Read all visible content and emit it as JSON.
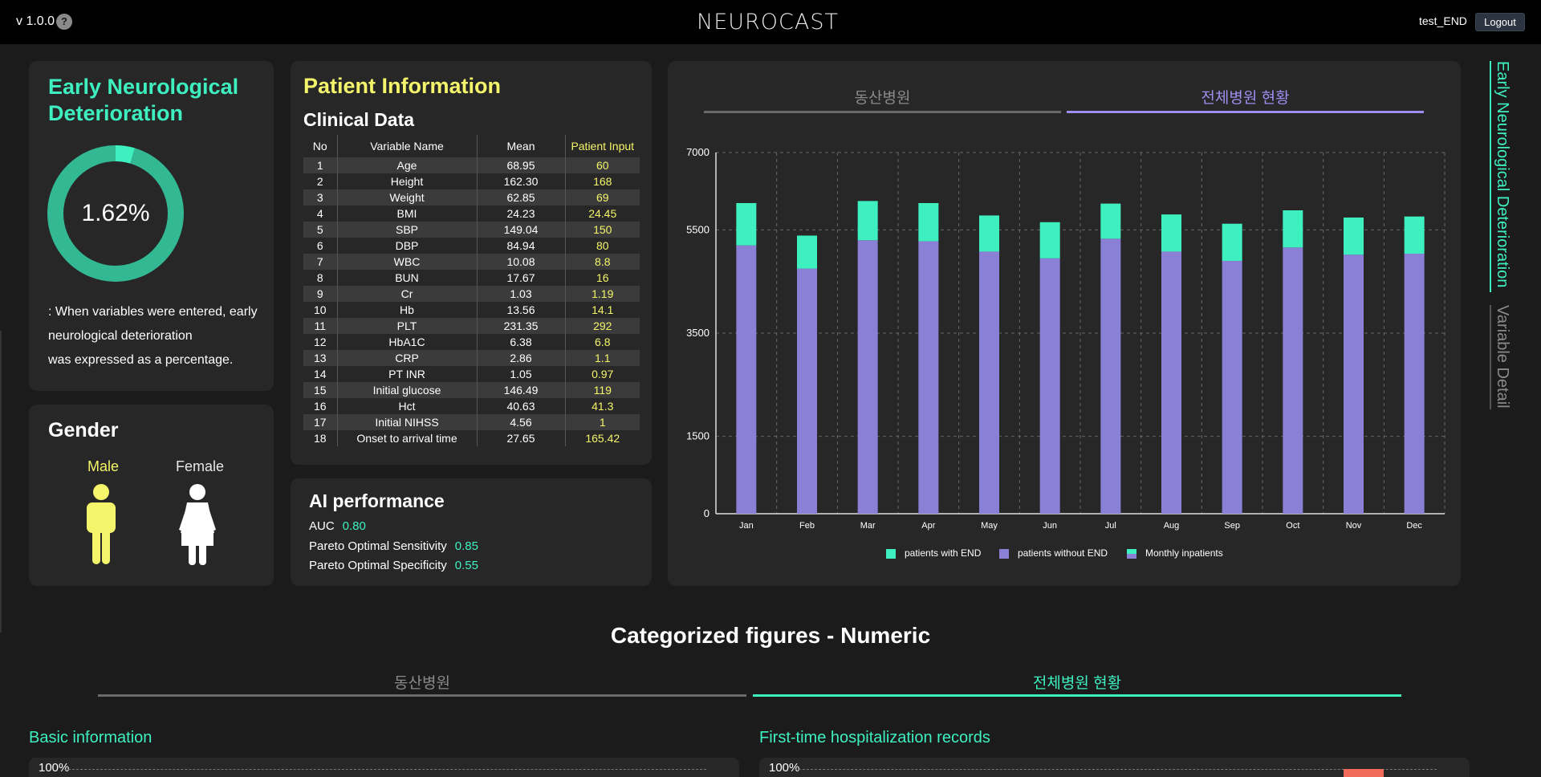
{
  "header": {
    "version": "v 1.0.0",
    "help_icon": "?",
    "logo": "NEUROCAST",
    "username": "test_END",
    "logout_label": "Logout"
  },
  "end_card": {
    "title": "Early Neurological Deterioration",
    "percent_value": 1.62,
    "percent_label": "1.62%",
    "note_line1": ": When variables were entered, early",
    "note_line2": "neurological deterioration",
    "note_line3": "was expressed as a percentage.",
    "ring_color": "#33b894",
    "ring_highlight_color": "#3ef0c0"
  },
  "gender": {
    "title": "Gender",
    "male_label": "Male",
    "female_label": "Female",
    "selected": "Male",
    "male_color": "#f5f56b",
    "female_color": "#ffffff"
  },
  "patient_info": {
    "title": "Patient Information",
    "subtitle": "Clinical Data",
    "columns": [
      "No",
      "Variable Name",
      "Mean",
      "Patient Input"
    ],
    "rows": [
      {
        "no": "1",
        "name": "Age",
        "mean": "68.95",
        "input": "60"
      },
      {
        "no": "2",
        "name": "Height",
        "mean": "162.30",
        "input": "168"
      },
      {
        "no": "3",
        "name": "Weight",
        "mean": "62.85",
        "input": "69"
      },
      {
        "no": "4",
        "name": "BMI",
        "mean": "24.23",
        "input": "24.45"
      },
      {
        "no": "5",
        "name": "SBP",
        "mean": "149.04",
        "input": "150"
      },
      {
        "no": "6",
        "name": "DBP",
        "mean": "84.94",
        "input": "80"
      },
      {
        "no": "7",
        "name": "WBC",
        "mean": "10.08",
        "input": "8.8"
      },
      {
        "no": "8",
        "name": "BUN",
        "mean": "17.67",
        "input": "16"
      },
      {
        "no": "9",
        "name": "Cr",
        "mean": "1.03",
        "input": "1.19"
      },
      {
        "no": "10",
        "name": "Hb",
        "mean": "13.56",
        "input": "14.1"
      },
      {
        "no": "11",
        "name": "PLT",
        "mean": "231.35",
        "input": "292"
      },
      {
        "no": "12",
        "name": "HbA1C",
        "mean": "6.38",
        "input": "6.8"
      },
      {
        "no": "13",
        "name": "CRP",
        "mean": "2.86",
        "input": "1.1"
      },
      {
        "no": "14",
        "name": "PT INR",
        "mean": "1.05",
        "input": "0.97"
      },
      {
        "no": "15",
        "name": "Initial glucose",
        "mean": "146.49",
        "input": "119"
      },
      {
        "no": "16",
        "name": "Hct",
        "mean": "40.63",
        "input": "41.3"
      },
      {
        "no": "17",
        "name": "Initial NIHSS",
        "mean": "4.56",
        "input": "1"
      },
      {
        "no": "18",
        "name": "Onset to arrival time",
        "mean": "27.65",
        "input": "165.42"
      }
    ]
  },
  "ai_performance": {
    "title": "AI performance",
    "auc_label": "AUC",
    "auc_value": "0.80",
    "sensitivity_label": "Pareto Optimal Sensitivity",
    "sensitivity_value": "0.85",
    "specificity_label": "Pareto Optimal Specificity",
    "specificity_value": "0.55"
  },
  "inpatient_chart": {
    "tabs": [
      {
        "label": "동산병원",
        "active": false
      },
      {
        "label": "전체병원 현황",
        "active": true
      }
    ],
    "active_color": "#9c8ff0",
    "inactive_color": "#8a8a8a"
  },
  "chart_data": {
    "type": "bar",
    "stacked": true,
    "categories": [
      "Jan",
      "Feb",
      "Mar",
      "Apr",
      "May",
      "Jun",
      "Jul",
      "Aug",
      "Sep",
      "Oct",
      "Nov",
      "Dec"
    ],
    "series": [
      {
        "name": "patients without END",
        "color": "#8a80d6",
        "values": [
          5200,
          4750,
          5300,
          5280,
          5080,
          4950,
          5330,
          5080,
          4900,
          5160,
          5020,
          5040
        ]
      },
      {
        "name": "patients with END",
        "color": "#3ef0c0",
        "values": [
          820,
          640,
          760,
          740,
          700,
          700,
          680,
          720,
          720,
          720,
          720,
          720
        ]
      }
    ],
    "legend": [
      "patients with END",
      "patients without END",
      "Monthly inpatients"
    ],
    "legend_placement": "bottom",
    "yticks": [
      0,
      1500,
      3500,
      5500,
      7000
    ],
    "ylim": [
      0,
      7000
    ],
    "grid": true
  },
  "vertical_nav": {
    "items": [
      {
        "label": "Early Neurological Deterioration",
        "active": true
      },
      {
        "label": "Variable Detail",
        "active": false
      }
    ]
  },
  "categorized": {
    "title": "Categorized figures - Numeric",
    "tabs": [
      {
        "label": "동산병원",
        "active": false
      },
      {
        "label": "전체병원 현황",
        "active": true
      }
    ],
    "sections": [
      {
        "label": "Basic information",
        "axis_label": "100%"
      },
      {
        "label": "First-time hospitalization records",
        "axis_label": "100%"
      }
    ]
  }
}
